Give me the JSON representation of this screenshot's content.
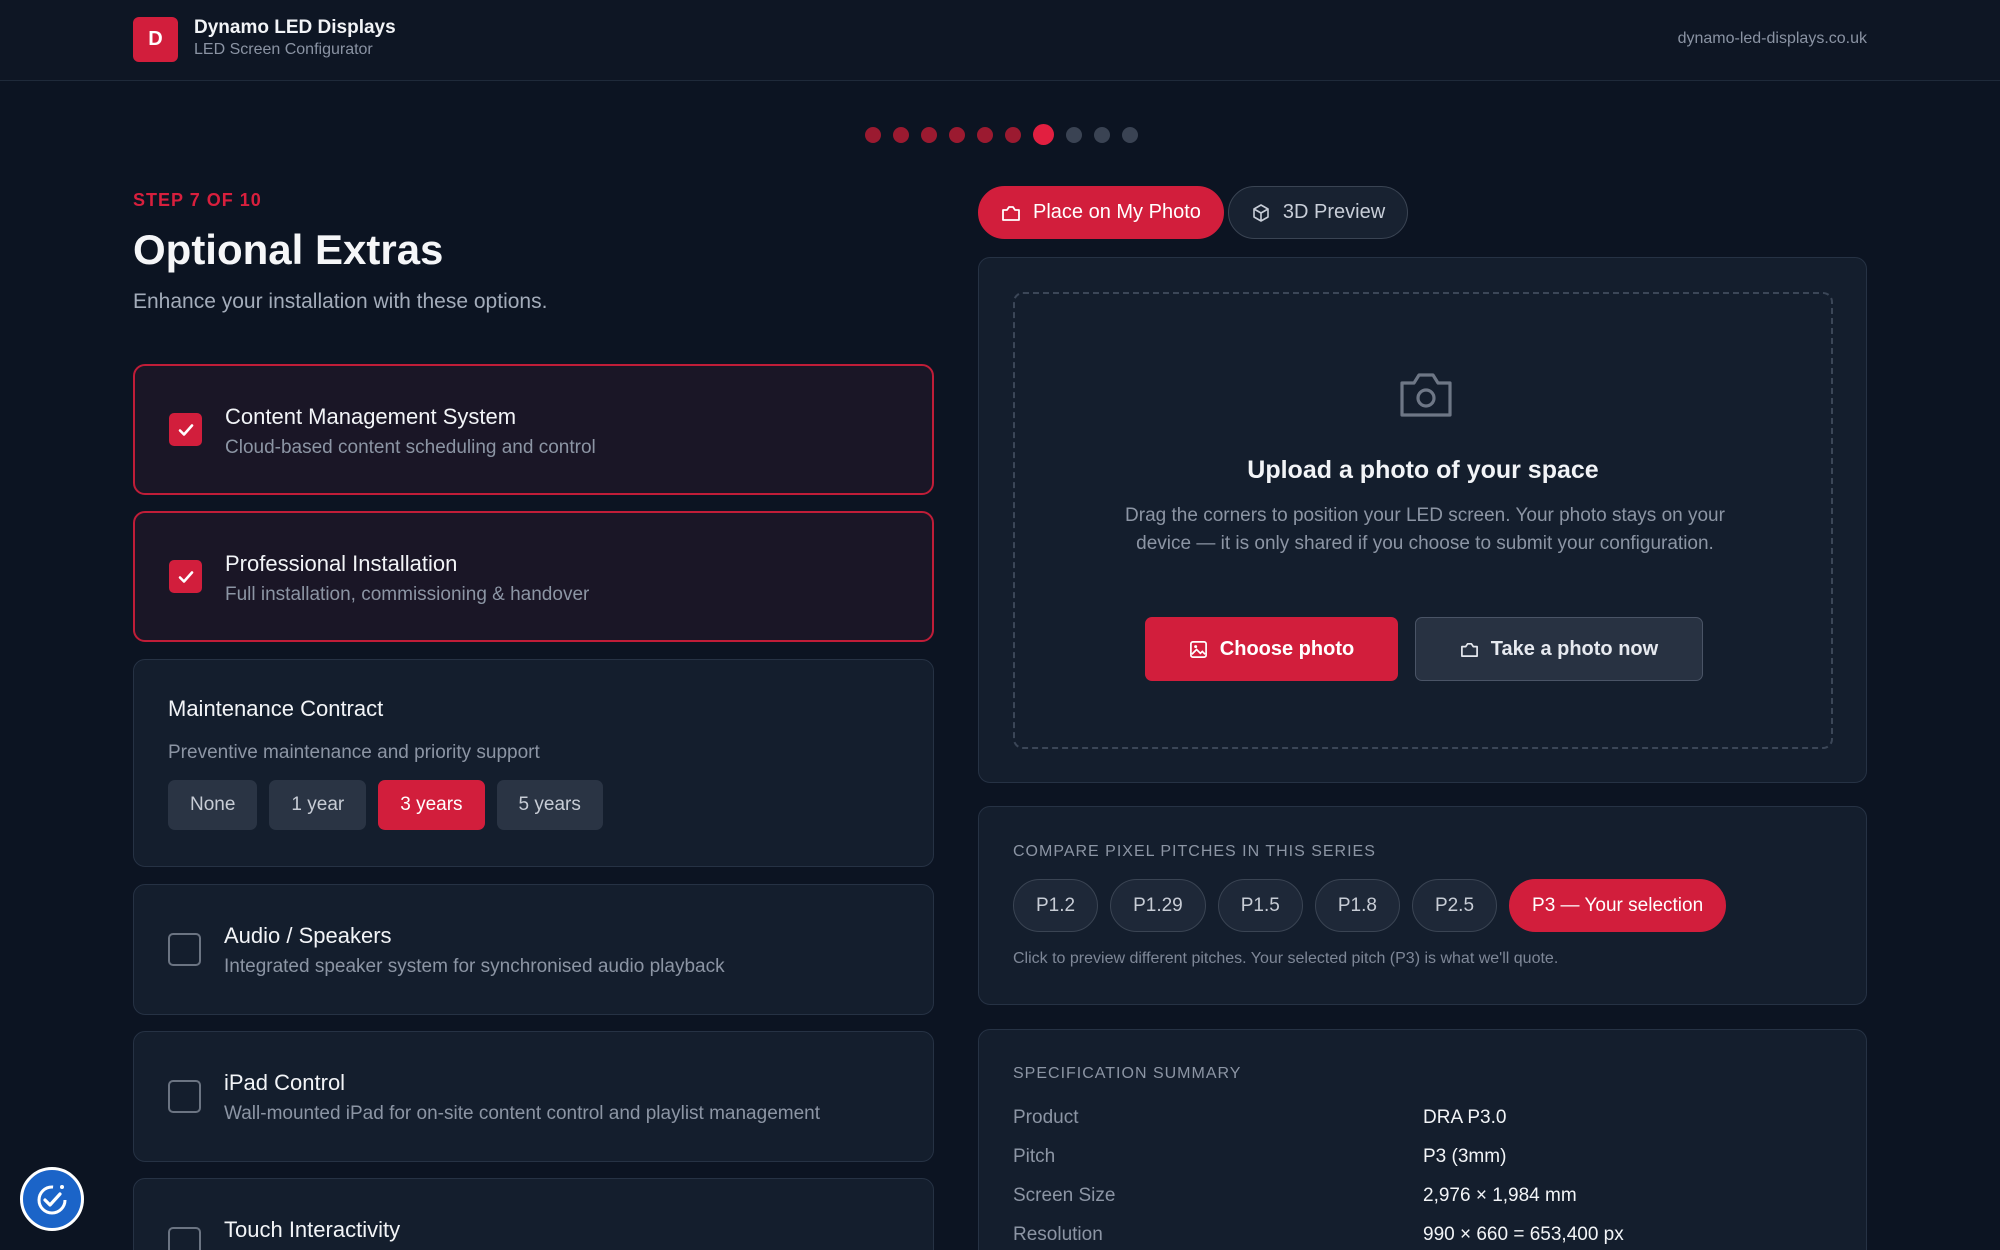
{
  "header": {
    "logo_letter": "D",
    "brand_name": "Dynamo LED Displays",
    "brand_sub": "LED Screen Configurator",
    "domain": "dynamo-led-displays.co.uk"
  },
  "progress": {
    "total_steps": 10,
    "current_step": 7
  },
  "step_label": "STEP 7 OF 10",
  "page_title": "Optional Extras",
  "page_subtitle": "Enhance your installation with these options.",
  "extras": [
    {
      "title": "Content Management System",
      "desc": "Cloud-based content scheduling and control",
      "checked": true
    },
    {
      "title": "Professional Installation",
      "desc": "Full installation, commissioning & handover",
      "checked": true
    },
    {
      "title": "Audio / Speakers",
      "desc": "Integrated speaker system for synchronised audio playback",
      "checked": false
    },
    {
      "title": "iPad Control",
      "desc": "Wall-mounted iPad for on-site content control and playlist management",
      "checked": false
    },
    {
      "title": "Touch Interactivity",
      "desc": "",
      "checked": false
    }
  ],
  "maintenance": {
    "title": "Maintenance Contract",
    "desc": "Preventive maintenance and priority support",
    "options": [
      "None",
      "1 year",
      "3 years",
      "5 years"
    ],
    "selected": "3 years"
  },
  "preview_tabs": [
    {
      "label": "Place on My Photo",
      "active": true,
      "icon": "camera-icon"
    },
    {
      "label": "3D Preview",
      "active": false,
      "icon": "cube-icon"
    }
  ],
  "upload": {
    "title": "Upload a photo of your space",
    "desc": "Drag the corners to position your LED screen. Your photo stays on your device — it is only shared if you choose to submit your configuration.",
    "choose_label": "Choose photo",
    "take_label": "Take a photo now"
  },
  "pitch_compare": {
    "label": "COMPARE PIXEL PITCHES IN THIS SERIES",
    "options": [
      "P1.2",
      "P1.29",
      "P1.5",
      "P1.8",
      "P2.5",
      "P3 — Your selection"
    ],
    "selected_index": 5,
    "note": "Click to preview different pitches. Your selected pitch (P3) is what we'll quote."
  },
  "spec_summary": {
    "label": "SPECIFICATION SUMMARY",
    "rows": [
      {
        "key": "Product",
        "value": "DRA P3.0"
      },
      {
        "key": "Pitch",
        "value": "P3 (3mm)"
      },
      {
        "key": "Screen Size",
        "value": "2,976 × 1,984 mm"
      },
      {
        "key": "Resolution",
        "value": "990 × 660 = 653,400 px"
      }
    ]
  },
  "colors": {
    "accent": "#d21e3c",
    "background": "#0c1422",
    "card": "#141e2d"
  }
}
